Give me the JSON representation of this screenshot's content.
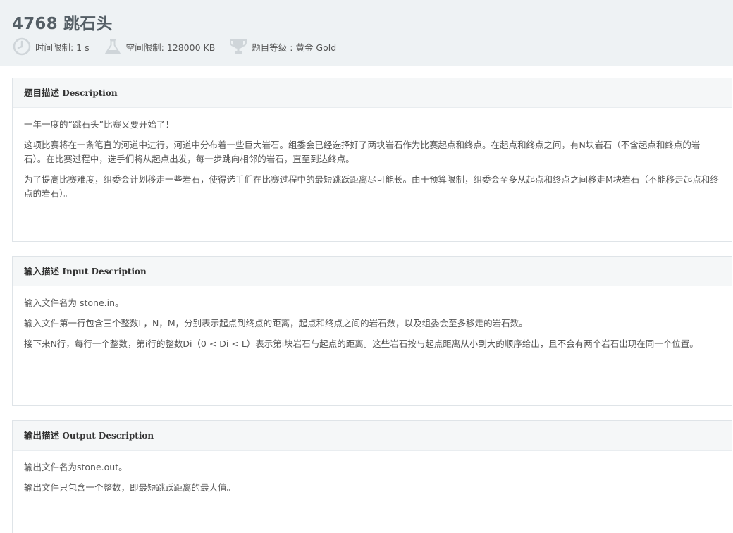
{
  "problem": {
    "title": "4768 跳石头",
    "time_limit": "时间限制: 1 s",
    "memory_limit": "空间限制: 128000 KB",
    "level": "题目等级 : 黄金 Gold"
  },
  "icons": {
    "time": "clock-icon",
    "memory": "flask-icon",
    "level": "trophy-icon",
    "color": "#cfd5d9"
  },
  "sections": {
    "description": {
      "heading_cn": "题目描述",
      "heading_en": "Description",
      "paragraphs": [
        "一年一度的“跳石头”比赛又要开始了！",
        "这项比赛将在一条笔直的河道中进行，河道中分布着一些巨大岩石。组委会已经选择好了两块岩石作为比赛起点和终点。在起点和终点之间，有N块岩石（不含起点和终点的岩石）。在比赛过程中，选手们将从起点出发，每一步跳向相邻的岩石，直至到达终点。",
        "为了提高比赛难度，组委会计划移走一些岩石，使得选手们在比赛过程中的最短跳跃距离尽可能长。由于预算限制，组委会至多从起点和终点之间移走M块岩石（不能移走起点和终点的岩石）。"
      ]
    },
    "input": {
      "heading_cn": "输入描述",
      "heading_en": "Input Description",
      "paragraphs": [
        "输入文件名为 stone.in。",
        "输入文件第一行包含三个整数L，N，M，分别表示起点到终点的距离，起点和终点之间的岩石数，以及组委会至多移走的岩石数。",
        "接下来N行，每行一个整数，第i行的整数Di（0 < Di < L）表示第i块岩石与起点的距离。这些岩石按与起点距离从小到大的顺序给出，且不会有两个岩石出现在同一个位置。"
      ]
    },
    "output": {
      "heading_cn": "输出描述",
      "heading_en": "Output Description",
      "paragraphs": [
        "输出文件名为stone.out。",
        "输出文件只包含一个整数，即最短跳跃距离的最大值。"
      ]
    }
  }
}
